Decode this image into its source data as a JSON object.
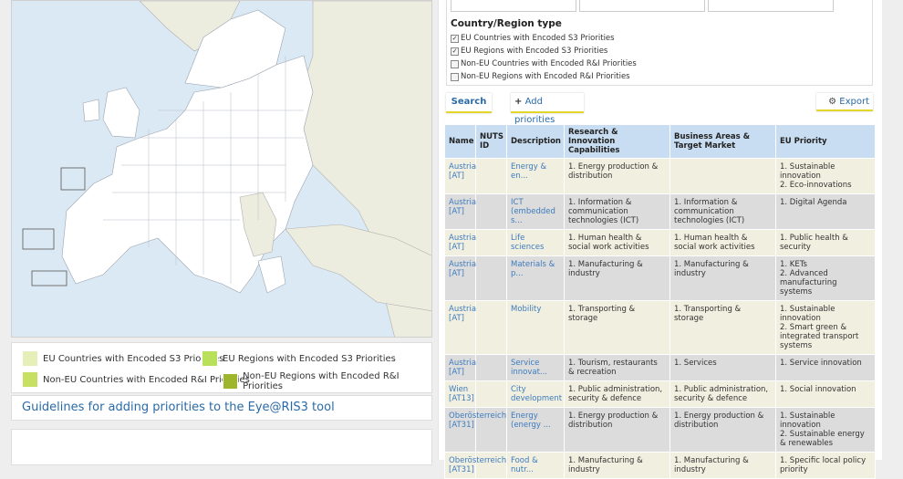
{
  "legend": [
    {
      "label": "EU Countries with Encoded S3 Priorities",
      "color": "#e6efb8"
    },
    {
      "label": "EU Regions with Encoded S3 Priorities",
      "color": "#b8e05a"
    },
    {
      "label": "Non-EU Countries with Encoded R&I Priorities",
      "color": "#c7df62"
    },
    {
      "label": "Non-EU Regions with Encoded R&I Priorities",
      "color": "#9db62e"
    }
  ],
  "guidelines_link": "Guidelines for adding priorities to the Eye@RIS3 tool",
  "filter": {
    "title": "Country/Region type",
    "options": [
      {
        "label": "EU Countries with Encoded S3 Priorities",
        "checked": true
      },
      {
        "label": "EU Regions with Encoded S3 Priorities",
        "checked": true
      },
      {
        "label": "Non-EU Countries with Encoded R&I Priorities",
        "checked": false
      },
      {
        "label": "Non-EU Regions with Encoded R&I Priorities",
        "checked": false
      }
    ]
  },
  "buttons": {
    "search": "Search",
    "add": "Add priorities",
    "export": "Export"
  },
  "table": {
    "headers": [
      "Name",
      "NUTS ID",
      "Description",
      "Research & Innovation Capabilities",
      "Business Areas & Target Market",
      "EU Priority"
    ],
    "rows": [
      [
        "Austria [AT]",
        "",
        "Energy & en...",
        "1. Energy production & distribution",
        "",
        "1. Sustainable innovation\n2. Eco-innovations"
      ],
      [
        "Austria [AT]",
        "",
        "ICT (embedded s...",
        "1. Information & communication technologies (ICT)",
        "1. Information & communication technologies (ICT)",
        "1. Digital Agenda"
      ],
      [
        "Austria [AT]",
        "",
        "Life sciences",
        "1. Human health & social work activities",
        "1. Human health & social work activities",
        "1. Public health & security"
      ],
      [
        "Austria [AT]",
        "",
        "Materials & p...",
        "1. Manufacturing & industry",
        "1. Manufacturing & industry",
        "1. KETs\n2. Advanced manufacturing systems"
      ],
      [
        "Austria [AT]",
        "",
        "Mobility",
        "1. Transporting & storage",
        "1. Transporting & storage",
        "1. Sustainable innovation\n2. Smart green & integrated transport systems"
      ],
      [
        "Austria [AT]",
        "",
        "Service innovat...",
        "1. Tourism, restaurants & recreation",
        "1. Services",
        "1. Service innovation"
      ],
      [
        "Wien [AT13]",
        "",
        "City development",
        "1. Public administration, security & defence",
        "1. Public administration, security & defence",
        "1. Social innovation"
      ],
      [
        "Oberösterreich [AT31]",
        "",
        "Energy (energy ...",
        "1. Energy production & distribution",
        "1. Energy production & distribution",
        "1. Sustainable innovation\n2. Sustainable energy & renewables"
      ],
      [
        "Oberösterreich [AT31]",
        "",
        "Food & nutr...",
        "1. Manufacturing & industry",
        "1. Manufacturing & industry",
        "1. Specific local policy priority"
      ]
    ]
  }
}
